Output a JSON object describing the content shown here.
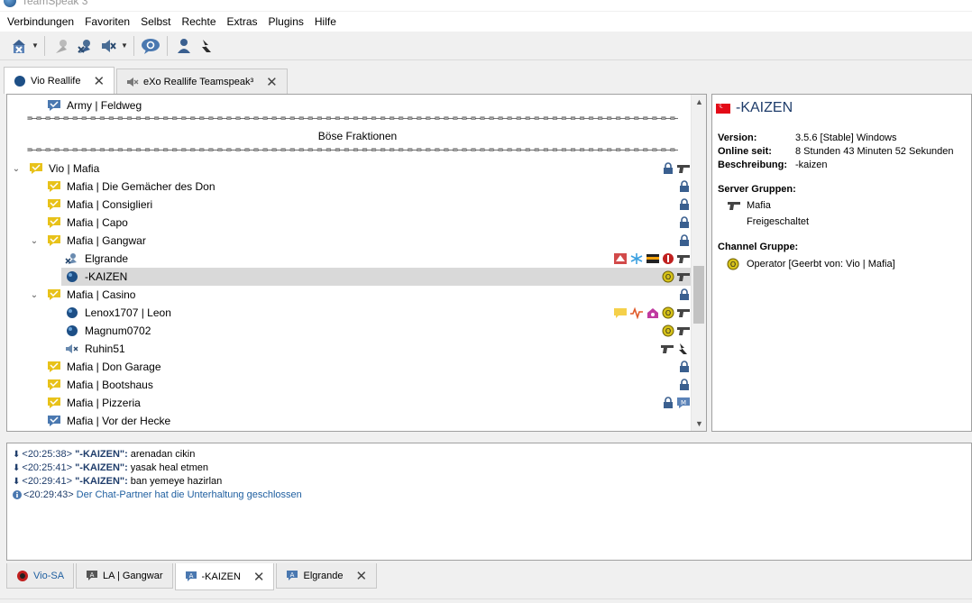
{
  "window": {
    "title": "TeamSpeak 3"
  },
  "menu": [
    "Verbindungen",
    "Favoriten",
    "Selbst",
    "Rechte",
    "Extras",
    "Plugins",
    "Hilfe"
  ],
  "server_tabs": [
    {
      "label": "Vio Reallife",
      "active": true
    },
    {
      "label": "eXo Reallife Teamspeak³",
      "active": false
    }
  ],
  "tree": {
    "army": "Army | Feldweg",
    "spacer_top": "=–=–=–=–=–=–=–=–=–=–=–=–=–=–=–=–=–=–=–=–=–=–=–=–=–=–=–=–=–=–=–=–=–=–=–=–=–=–=–=–=–=–=–=–=–=–=–=–=–=–=–=–=–=–=–=–=–=–=–=–=–=–=–=–=–=–=–=–=–=–=–=–=–=–=–=–=–=–=–=–=–=–=–=–=–=–=–=–=–=–=–=–=–=–=–=–=–=–=–=–=–=–=–=–=–=",
    "spacer_title": "Böse Fraktionen",
    "spacer_bottom": "=–=–=–=–=–=–=–=–=–=–=–=–=–=–=–=–=–=–=–=–=–=–=–=–=–=–=–=–=–=–=–=–=–=–=–=–=–=–=–=–=–=–=–=–=–=–=–=–=–=–=–=–=–=–=–=–=–=–=–=–=–=–=–=–=–=–=–=–=–=–=–=–=–=–=–=–=–=–=–=–=–=–=–=–=–=–=–=–=–=–=–=–=–=–=–=–=–=–=–=–=–=–=–=–=–=",
    "vio_mafia": "Vio | Mafia",
    "gemaecher": "Mafia | Die Gemächer des Don",
    "consiglieri": "Mafia | Consiglieri",
    "capo": "Mafia | Capo",
    "gangwar": "Mafia | Gangwar",
    "elgrande": "Elgrande",
    "kaizen": "-KAIZEN",
    "casino": "Mafia | Casino",
    "lenox": "Lenox1707 | Leon",
    "magnum": "Magnum0702",
    "ruhin": "Ruhin51",
    "garage": "Mafia | Don Garage",
    "bootshaus": "Mafia | Bootshaus",
    "pizzeria": "Mafia | Pizzeria",
    "hecke": "Mafia | Vor der Hecke"
  },
  "info": {
    "nickname": "-KAIZEN",
    "version_label": "Version:",
    "version_value": "3.5.6 [Stable] Windows",
    "online_label": "Online seit:",
    "online_value": "8 Stunden 43 Minuten 52 Sekunden",
    "desc_label": "Beschreibung:",
    "desc_value": "-kaizen",
    "server_groups_label": "Server Gruppen:",
    "server_group_1": "Mafia",
    "server_group_2": "Freigeschaltet",
    "channel_group_label": "Channel Gruppe:",
    "channel_group": "Operator [Geerbt von: Vio | Mafia]"
  },
  "chat": [
    {
      "time": "<20:25:38>",
      "who": "\"-KAIZEN\":",
      "msg": "arenadan cikin"
    },
    {
      "time": "<20:25:41>",
      "who": "\"-KAIZEN\":",
      "msg": "yasak heal etmen"
    },
    {
      "time": "<20:29:41>",
      "who": "\"-KAIZEN\":",
      "msg": "ban yemeye hazirlan"
    },
    {
      "time": "<20:29:43>",
      "sys": "Der Chat-Partner hat die Unterhaltung geschlossen"
    }
  ],
  "chat_tabs": [
    {
      "label": "Vio-SA",
      "active": false
    },
    {
      "label": "LA | Gangwar",
      "active": false
    },
    {
      "label": "-KAIZEN",
      "active": true
    },
    {
      "label": "Elgrande",
      "active": false
    }
  ],
  "colors": {
    "accent": "#1f3d6b",
    "channel_yellow": "#e8c21a",
    "channel_blue": "#4a78b0",
    "selection": "#d9d9d9"
  }
}
